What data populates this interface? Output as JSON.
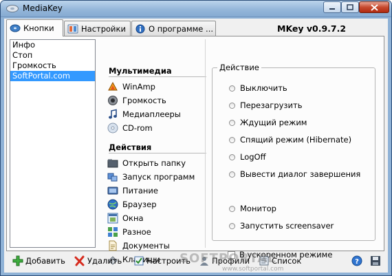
{
  "window": {
    "title": "MediaKey"
  },
  "tabs": [
    {
      "label": "Кнопки"
    },
    {
      "label": "Настройки"
    },
    {
      "label": "О программе ..."
    }
  ],
  "version": "MKey v0.9.7.2",
  "list_items": [
    {
      "label": "Инфо"
    },
    {
      "label": "Стоп"
    },
    {
      "label": "Громкость"
    },
    {
      "label": "SoftPortal.com",
      "selected": true
    }
  ],
  "multimedia": {
    "header": "Мультимедиа",
    "items": [
      {
        "label": "WinAmp",
        "icon": "winamp-icon"
      },
      {
        "label": "Громкость",
        "icon": "speaker-icon"
      },
      {
        "label": "Медиаплееры",
        "icon": "music-note-icon"
      },
      {
        "label": "CD-rom",
        "icon": "cd-icon"
      }
    ]
  },
  "actions": {
    "header": "Действия",
    "items": [
      {
        "label": "Открыть папку",
        "icon": "folder-icon"
      },
      {
        "label": "Запуск программ",
        "icon": "programs-icon"
      },
      {
        "label": "Питание",
        "icon": "power-icon"
      },
      {
        "label": "Браузер",
        "icon": "globe-icon"
      },
      {
        "label": "Окна",
        "icon": "windows-icon"
      },
      {
        "label": "Разное",
        "icon": "misc-icon"
      },
      {
        "label": "Документы",
        "icon": "documents-icon"
      },
      {
        "label": "Клавиши",
        "icon": "keys-icon"
      }
    ]
  },
  "action_group": {
    "legend": "Действие",
    "options": [
      {
        "label": "Выключить"
      },
      {
        "label": "Перезагрузить"
      },
      {
        "label": "Ждущий режим"
      },
      {
        "label": "Спящий режим (Hibernate)"
      },
      {
        "label": "LogOff"
      },
      {
        "label": "Вывести диалог завершения"
      },
      {
        "label": "Монитор"
      },
      {
        "label": "Запустить screensaver"
      }
    ]
  },
  "fast_mode": {
    "label": "В ускоренном режиме",
    "checked": false
  },
  "bottom_bar": {
    "add": "Добавить",
    "delete": "Удалить",
    "configure": "Настроить",
    "profiles": "Профили",
    "list": "Список"
  },
  "watermark": {
    "big": "SOFTPORTAL",
    "small": "www.softportal.com"
  },
  "colors": {
    "selection": "#3399ff",
    "titlebar": "#95b7da"
  }
}
